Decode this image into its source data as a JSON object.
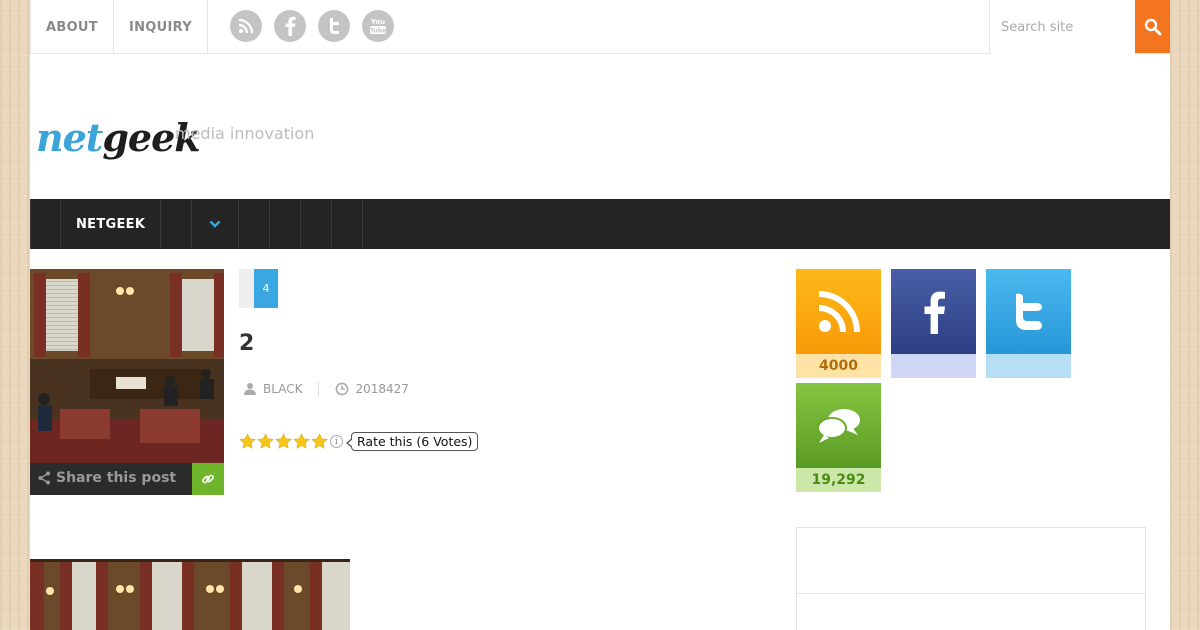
{
  "topnav": {
    "items": [
      {
        "label": "ABOUT"
      },
      {
        "label": "INQUIRY"
      }
    ]
  },
  "social_top": [
    "rss-icon",
    "facebook-icon",
    "twitter-icon",
    "youtube-icon"
  ],
  "search": {
    "placeholder": "Search site"
  },
  "header": {
    "logo_net": "net",
    "logo_geek": "geek",
    "tagline": "media innovation"
  },
  "mainnav": {
    "home": "NETGEEK"
  },
  "post": {
    "category_count": "4",
    "title": "2",
    "author": "BLACK",
    "date": "2018427",
    "share_label": "Share this post",
    "rating": {
      "stars": 5,
      "max": 5,
      "tooltip": "Rate this (6 Votes)"
    }
  },
  "sidebar": {
    "rss_count": "4000",
    "facebook_count": "",
    "twitter_count": "",
    "comments_count": "19,292"
  },
  "colors": {
    "accent_orange": "#f3751f",
    "accent_blue": "#3aa7e1",
    "nav_dark": "#242424",
    "share_green": "#6fb52c"
  }
}
